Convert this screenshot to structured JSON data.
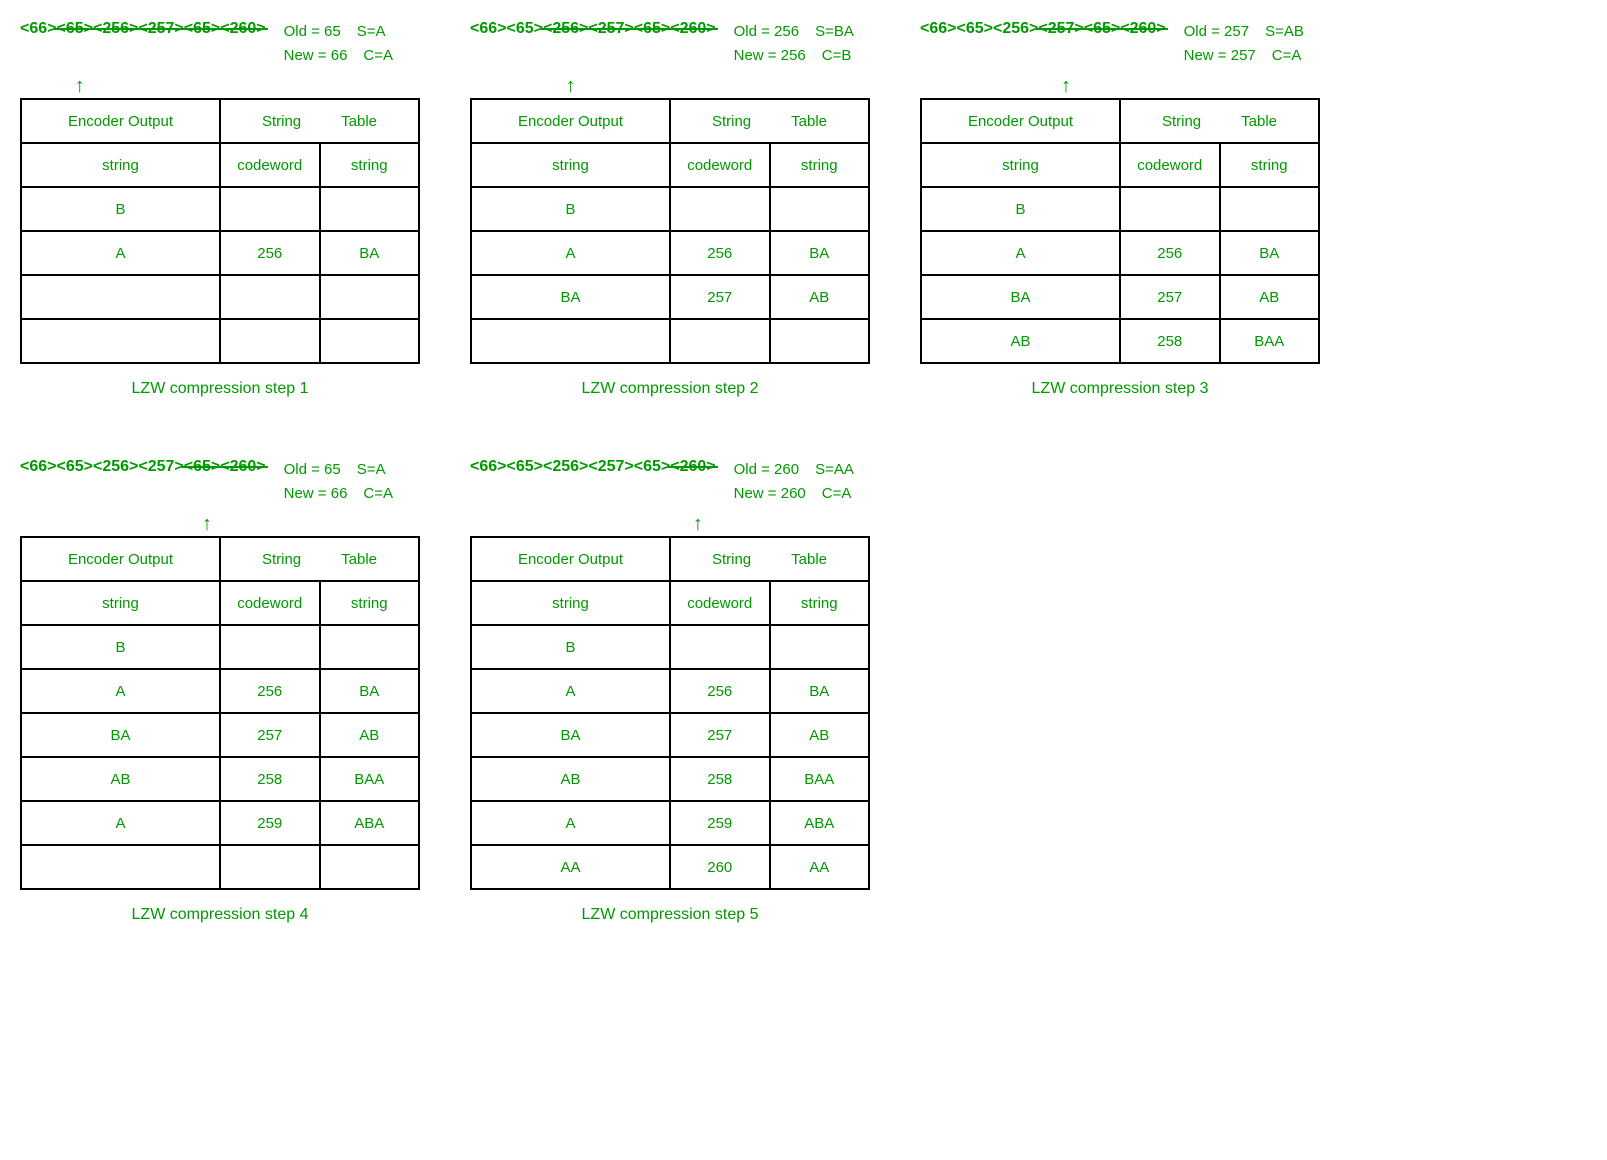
{
  "panels": [
    {
      "codes": [
        "<66>",
        "<65>",
        "<256>",
        "<257>",
        "<65>",
        "<260>"
      ],
      "strike_indices": [
        1,
        2,
        3,
        4,
        5
      ],
      "arrow_index": 1,
      "old": "Old = 65",
      "s": "S=A",
      "new": "New = 66",
      "c": "C=A",
      "header1": "Encoder Output",
      "header2": "String",
      "header3": "Table",
      "sub1": "string",
      "sub2": "codeword",
      "sub3": "string",
      "rows": [
        {
          "out": "B",
          "cw": "",
          "str": ""
        },
        {
          "out": "A",
          "cw": "256",
          "str": "BA"
        },
        {
          "out": "",
          "cw": "",
          "str": ""
        },
        {
          "out": "",
          "cw": "",
          "str": ""
        }
      ],
      "caption": "LZW compression step 1"
    },
    {
      "codes": [
        "<66>",
        "<65>",
        "<256>",
        "<257>",
        "<65>",
        "<260>"
      ],
      "strike_indices": [
        2,
        3,
        4,
        5
      ],
      "arrow_index": 2,
      "old": "Old = 256",
      "s": "S=BA",
      "new": "New = 256",
      "c": "C=B",
      "header1": "Encoder Output",
      "header2": "String",
      "header3": "Table",
      "sub1": "string",
      "sub2": "codeword",
      "sub3": "string",
      "rows": [
        {
          "out": "B",
          "cw": "",
          "str": ""
        },
        {
          "out": "A",
          "cw": "256",
          "str": "BA"
        },
        {
          "out": "BA",
          "cw": "257",
          "str": "AB"
        },
        {
          "out": "",
          "cw": "",
          "str": ""
        }
      ],
      "caption": "LZW compression step 2"
    },
    {
      "codes": [
        "<66>",
        "<65>",
        "<256>",
        "<257>",
        "<65>",
        "<260>"
      ],
      "strike_indices": [
        3,
        4,
        5
      ],
      "arrow_index": 3,
      "old": "Old = 257",
      "s": "S=AB",
      "new": "New = 257",
      "c": "C=A",
      "header1": "Encoder Output",
      "header2": "String",
      "header3": "Table",
      "sub1": "string",
      "sub2": "codeword",
      "sub3": "string",
      "rows": [
        {
          "out": "B",
          "cw": "",
          "str": ""
        },
        {
          "out": "A",
          "cw": "256",
          "str": "BA"
        },
        {
          "out": "BA",
          "cw": "257",
          "str": "AB"
        },
        {
          "out": "AB",
          "cw": "258",
          "str": "BAA"
        }
      ],
      "caption": "LZW compression step 3"
    },
    {
      "codes": [
        "<66>",
        "<65>",
        "<256>",
        "<257>",
        "<65>",
        "<260>"
      ],
      "strike_indices": [
        4,
        5
      ],
      "arrow_index": 4,
      "old": "Old = 65",
      "s": "S=A",
      "new": "New = 66",
      "c": "C=A",
      "header1": "Encoder Output",
      "header2": "String",
      "header3": "Table",
      "sub1": "string",
      "sub2": "codeword",
      "sub3": "string",
      "rows": [
        {
          "out": "B",
          "cw": "",
          "str": ""
        },
        {
          "out": "A",
          "cw": "256",
          "str": "BA"
        },
        {
          "out": "BA",
          "cw": "257",
          "str": "AB"
        },
        {
          "out": "AB",
          "cw": "258",
          "str": "BAA"
        },
        {
          "out": "A",
          "cw": "259",
          "str": "ABA"
        },
        {
          "out": "",
          "cw": "",
          "str": ""
        }
      ],
      "caption": "LZW compression step 4"
    },
    {
      "codes": [
        "<66>",
        "<65>",
        "<256>",
        "<257>",
        "<65>",
        "<260>"
      ],
      "strike_indices": [
        5
      ],
      "arrow_index": 5,
      "old": "Old = 260",
      "s": "S=AA",
      "new": "New = 260",
      "c": "C=A",
      "header1": "Encoder Output",
      "header2": "String",
      "header3": "Table",
      "sub1": "string",
      "sub2": "codeword",
      "sub3": "string",
      "rows": [
        {
          "out": "B",
          "cw": "",
          "str": ""
        },
        {
          "out": "A",
          "cw": "256",
          "str": "BA"
        },
        {
          "out": "BA",
          "cw": "257",
          "str": "AB"
        },
        {
          "out": "AB",
          "cw": "258",
          "str": "BAA"
        },
        {
          "out": "A",
          "cw": "259",
          "str": "ABA"
        },
        {
          "out": "AA",
          "cw": "260",
          "str": "AA"
        }
      ],
      "caption": "LZW compression step 5"
    }
  ]
}
